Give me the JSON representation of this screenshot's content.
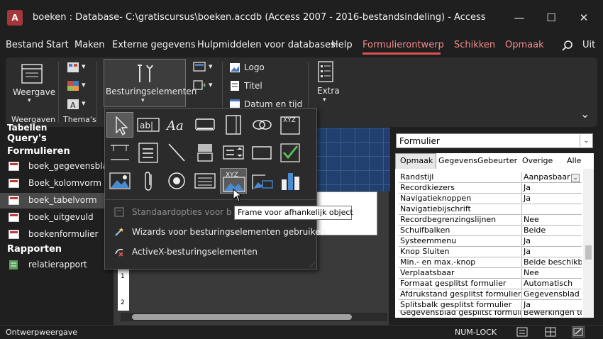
{
  "window": {
    "app_badge": "A",
    "title": "boeken : Database- C:\\gratiscursus\\boeken.accdb (Access 2007 - 2016-bestandsindeling)  -  Access",
    "minimize": "—",
    "maximize": "☐",
    "close": "✕"
  },
  "menu": [
    {
      "label": "Bestand"
    },
    {
      "label": "Start"
    },
    {
      "label": "Maken"
    },
    {
      "label": "Externe gegevens"
    },
    {
      "label": "Hulpmiddelen voor databases"
    },
    {
      "label": "Help"
    },
    {
      "label": "Formulierontwerp"
    },
    {
      "label": "Schikken"
    },
    {
      "label": "Opmaak"
    },
    {
      "label": "Uit"
    }
  ],
  "ribbon": {
    "view_label": "Weergave",
    "views_group": "Weergaven",
    "themes_group": "Thema's",
    "controls_label": "Besturingselementen",
    "logo": "Logo",
    "title": "Titel",
    "datetime": "Datum en tijd",
    "extra": "Extra",
    "collapse_glyph": "⌄"
  },
  "controls_menu": {
    "label_glyph": "Aa",
    "textbox_glyph": "ab|",
    "frame_glyph": "XYZ",
    "options": [
      {
        "label": "Standaardopties voor besturingselementen"
      },
      {
        "label": "Wizards voor besturingselementen gebruiken"
      },
      {
        "label": "ActiveX-besturingselementen"
      }
    ],
    "tooltip": "Frame voor afhankelijk object"
  },
  "nav": {
    "sections": [
      {
        "label": "Tabellen"
      },
      {
        "label": "Query's"
      },
      {
        "label": "Formulieren"
      },
      {
        "label": "Rapporten"
      }
    ],
    "forms": [
      {
        "label": "boek_gegevensblad"
      },
      {
        "label": "Boek_kolomvorm"
      },
      {
        "label": "boek_tabelvorm"
      },
      {
        "label": "boek_uitgevuld"
      },
      {
        "label": "boekenformulier"
      }
    ],
    "reports": [
      {
        "label": "relatierapport"
      }
    ]
  },
  "ruler": {
    "marks": [
      "1",
      "2"
    ]
  },
  "property_sheet": {
    "selector": "Formulier",
    "tabs": [
      {
        "label": "Opmaak"
      },
      {
        "label": "Gegevens"
      },
      {
        "label": "Gebeurter"
      },
      {
        "label": "Overige"
      },
      {
        "label": "Alle"
      }
    ],
    "rows": [
      {
        "name": "Randstijl",
        "value": "Aanpasbaar"
      },
      {
        "name": "Recordkiezers",
        "value": "Ja"
      },
      {
        "name": "Navigatieknoppen",
        "value": "Ja"
      },
      {
        "name": "Navigatiebijschrift",
        "value": ""
      },
      {
        "name": "Recordbegrenzingslijnen",
        "value": "Nee"
      },
      {
        "name": "Schuifbalken",
        "value": "Beide"
      },
      {
        "name": "Systeemmenu",
        "value": "Ja"
      },
      {
        "name": "Knop Sluiten",
        "value": "Ja"
      },
      {
        "name": "Min.- en max.-knop",
        "value": "Beide beschikbaar"
      },
      {
        "name": "Verplaatsbaar",
        "value": "Nee"
      },
      {
        "name": "Formaat gesplitst formulier",
        "value": "Automatisch"
      },
      {
        "name": "Afdrukstand gesplitst formulier",
        "value": "Gegevensblad boven"
      },
      {
        "name": "Splitsbalk gesplitst formulier",
        "value": "Ja"
      },
      {
        "name": "Gegevensblad gesplitst formulier",
        "value": "Bewerkingen toestaan"
      }
    ]
  },
  "status": {
    "left": "Ontwerpweergave",
    "numlock": "NUM-LOCK"
  },
  "colors": {
    "accent": "#f28b8b",
    "background": "#1f1f1f",
    "ribbon": "#2d2d2d",
    "selected_nav": "#4a4a4a",
    "form_grid": "#21406f"
  }
}
